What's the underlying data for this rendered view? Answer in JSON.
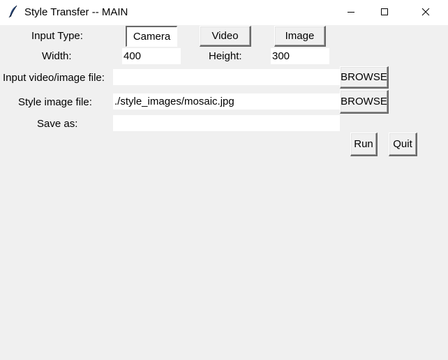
{
  "window": {
    "title": "Style Transfer -- MAIN"
  },
  "input_type": {
    "label": "Input Type:",
    "options": [
      "Camera",
      "Video",
      "Image"
    ],
    "selected": "Camera"
  },
  "size": {
    "width_label": "Width:",
    "width_value": "400",
    "height_label": "Height:",
    "height_value": "300"
  },
  "input_file": {
    "label": "Input video/image file:",
    "value": "",
    "browse_label": "BROWSE"
  },
  "style_file": {
    "label": "Style image file:",
    "value": "./style_images/mosaic.jpg",
    "browse_label": "BROWSE"
  },
  "save_as": {
    "label": "Save as:",
    "value": ""
  },
  "actions": {
    "run_label": "Run",
    "quit_label": "Quit"
  }
}
